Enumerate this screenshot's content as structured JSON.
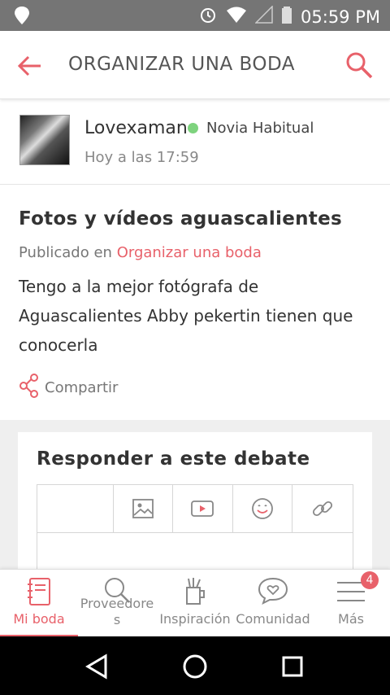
{
  "status_bar": {
    "time": "05:59 PM"
  },
  "app_bar": {
    "title": "ORGANIZAR UNA BODA"
  },
  "author": {
    "name": "Lovexaman",
    "role": "Novia Habitual",
    "posted": "Hoy a las 17:59"
  },
  "post": {
    "title": "Fotos y vídeos aguascalientes",
    "meta_prefix": "Publicado en",
    "category": "Organizar una boda",
    "body": "Tengo a la mejor fotógrafa de Aguascalientes Abby pekertin tienen que conocerla",
    "share_label": "Compartir"
  },
  "reply": {
    "title": "Responder a este debate",
    "tools": [
      "image-icon",
      "video-icon",
      "emoji-icon",
      "link-icon"
    ]
  },
  "bottom_nav": {
    "items": [
      {
        "label": "Mi boda",
        "icon": "notebook-icon",
        "active": true
      },
      {
        "label": "Proveedore\ns",
        "icon": "search-icon",
        "active": false
      },
      {
        "label": "Inspiración",
        "icon": "inspiration-icon",
        "active": false
      },
      {
        "label": "Comunidad",
        "icon": "community-icon",
        "active": false
      },
      {
        "label": "Más",
        "icon": "menu-icon",
        "active": false,
        "badge": "4"
      }
    ]
  },
  "colors": {
    "accent": "#e8616a",
    "status_bar": "#757575",
    "online": "#7ed37e"
  }
}
